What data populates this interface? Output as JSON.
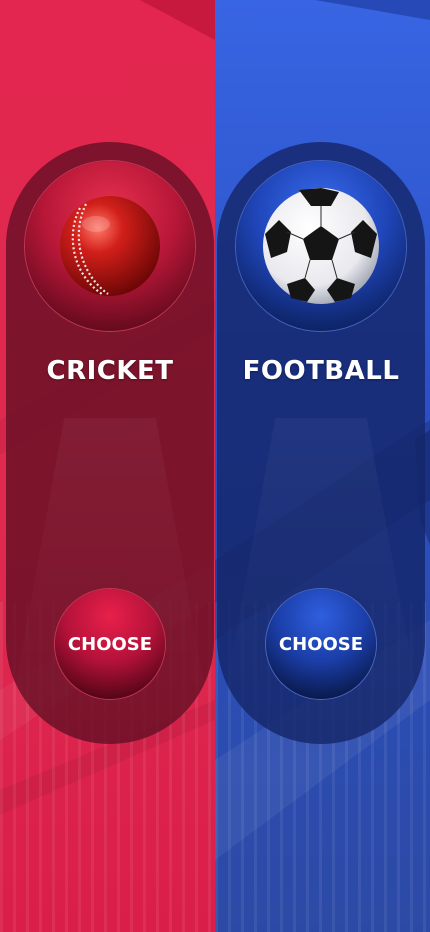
{
  "sports": [
    {
      "id": "cricket",
      "name": "CRICKET",
      "button_label": "CHOOSE",
      "icon": "cricket-ball-icon",
      "colors": {
        "background": "#e2264f",
        "panel": "#600e22",
        "button": "#b5123a"
      }
    },
    {
      "id": "football",
      "name": "FOOTBALL",
      "button_label": "CHOOSE",
      "icon": "football-icon",
      "colors": {
        "background": "#3865e3",
        "panel": "#142668",
        "button": "#1b3ea8"
      }
    }
  ]
}
